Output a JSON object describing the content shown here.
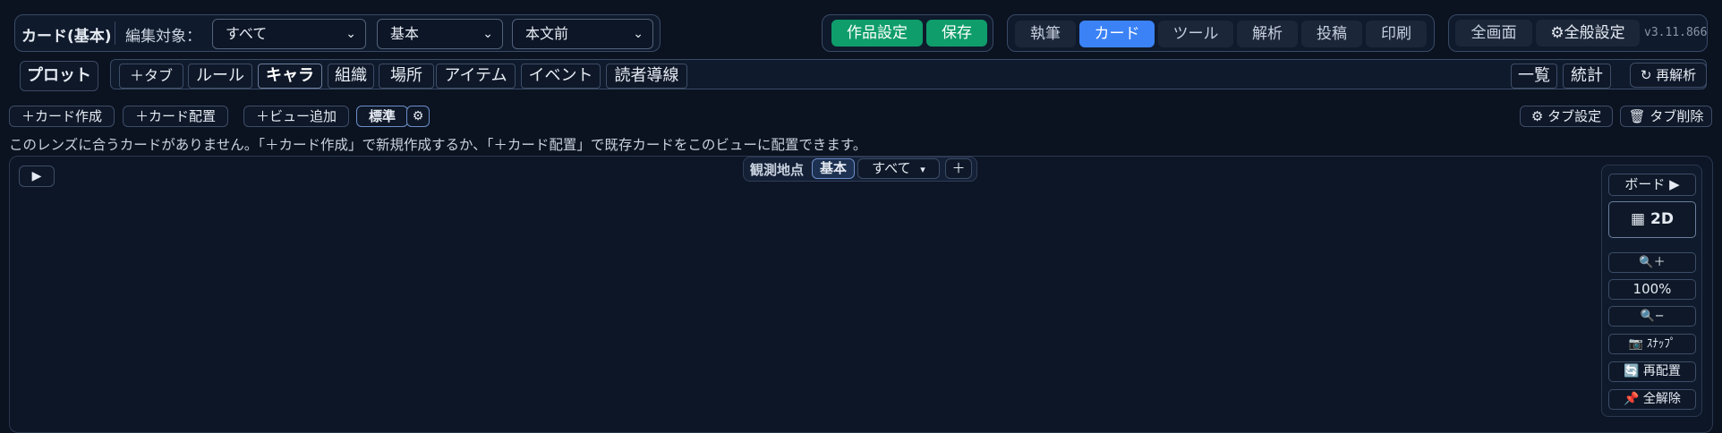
{
  "header": {
    "card_title": "カード(基本)",
    "edit_target_label": "編集対象：",
    "edit_target_value": "すべて",
    "category_value": "基本",
    "position_value": "本文前",
    "work_settings_label": "作品設定",
    "save_label": "保存",
    "mode_tabs": [
      {
        "label": "執筆",
        "active": false
      },
      {
        "label": "カード",
        "active": true
      },
      {
        "label": "ツール",
        "active": false
      },
      {
        "label": "解析",
        "active": false
      },
      {
        "label": "投稿",
        "active": false
      },
      {
        "label": "印刷",
        "active": false
      }
    ],
    "fullscreen_label": "全画面",
    "general_settings_label": "⚙全般設定",
    "version": "v3.11.866"
  },
  "subnav": {
    "plot_label": "プロット",
    "add_tab_label": "＋タブ",
    "tabs": [
      {
        "label": "ルール",
        "active": false
      },
      {
        "label": "キャラ",
        "active": true
      },
      {
        "label": "組織",
        "active": false
      },
      {
        "label": "場所",
        "active": false
      },
      {
        "label": "アイテム",
        "active": false
      },
      {
        "label": "イベント",
        "active": false
      },
      {
        "label": "読者導線",
        "active": false
      }
    ],
    "list_label": "一覧",
    "stats_label": "統計",
    "reanalyze_label": "↻ 再解析"
  },
  "toolbar": {
    "create_card_label": "＋カード作成",
    "place_card_label": "＋カード配置",
    "add_view_label": "＋ビュー追加",
    "standard_label": "標準",
    "gear_glyph": "⚙",
    "tab_settings_label": "⚙ タブ設定",
    "tab_delete_label": "🗑 タブ削除"
  },
  "message": "このレンズに合うカードがありません。「＋カード作成」で新規作成するか、「＋カード配置」で既存カードをこのビューに配置できます。",
  "canvas": {
    "play_glyph": "▶",
    "observation_label": "観測地点",
    "observation_base": "基本",
    "observation_filter": "すべて",
    "observation_filter_caret": "▾",
    "observation_add": "＋",
    "side": {
      "board_label": "ボード ▶",
      "view_2d_label": "▦ 2D",
      "zoom_in_label": "🔍＋",
      "zoom_level": "100%",
      "zoom_out_label": "🔍−",
      "snapshot_label": "📷 ｽﾅｯﾌﾟ",
      "rearrange_label": "🔄 再配置",
      "release_all_label": "📌 全解除"
    }
  },
  "colors": {
    "background": "#0b1220",
    "accent_green": "#0f9d6b",
    "accent_blue": "#3b82f6"
  }
}
